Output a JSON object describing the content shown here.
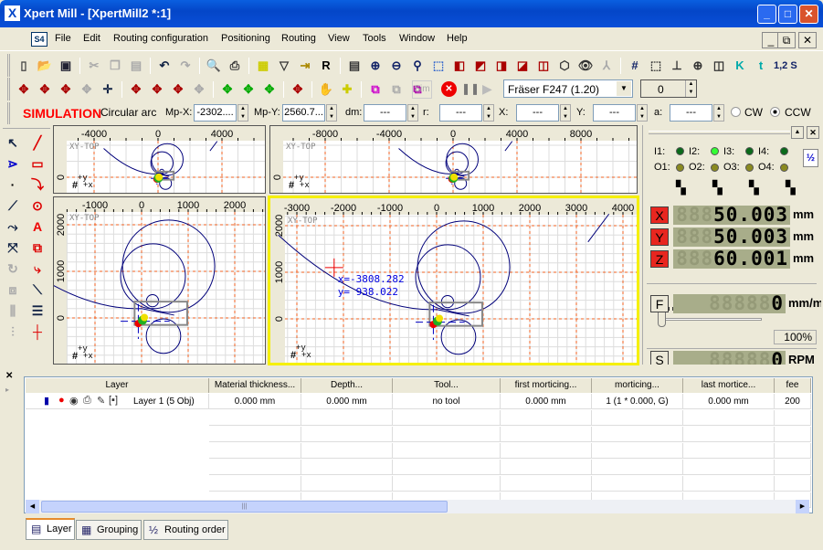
{
  "window": {
    "title": "Xpert Mill - [XpertMill2 *:1]",
    "app_icon": "X",
    "minimize": "_",
    "maximize": "□",
    "close": "✕"
  },
  "menu": {
    "logo": "S4",
    "items": [
      "File",
      "Edit",
      "Routing configuration",
      "Positioning",
      "Routing",
      "View",
      "Tools",
      "Window",
      "Help"
    ],
    "mdi": [
      "_",
      "⧉",
      "✕"
    ]
  },
  "toolbar1": [
    {
      "name": "new-icon",
      "g": "▯",
      "c": "#444"
    },
    {
      "name": "open-icon",
      "g": "📂",
      "c": "#c90"
    },
    {
      "name": "save-icon",
      "g": "▣",
      "c": "#223"
    },
    {
      "sep": true
    },
    {
      "name": "cut-icon",
      "g": "✂",
      "c": "#aaa"
    },
    {
      "name": "copy-icon",
      "g": "❐",
      "c": "#aaa"
    },
    {
      "name": "paste-icon",
      "g": "▤",
      "c": "#aaa"
    },
    {
      "sep": true
    },
    {
      "name": "undo-icon",
      "g": "↶",
      "c": "#124"
    },
    {
      "name": "redo-icon",
      "g": "↷",
      "c": "#aaa"
    },
    {
      "sep": true
    },
    {
      "name": "print-preview-icon",
      "g": "🔍",
      "c": "#333"
    },
    {
      "name": "print-icon",
      "g": "⎙",
      "c": "#333"
    },
    {
      "sep": true
    },
    {
      "name": "layer-icon",
      "g": "▦",
      "c": "#cc0"
    },
    {
      "name": "filter-icon",
      "g": "▽",
      "c": "#333"
    },
    {
      "name": "import-icon",
      "g": "⇥",
      "c": "#a80"
    },
    {
      "name": "r-icon",
      "g": "R",
      "c": "#000"
    },
    {
      "sep": true
    },
    {
      "name": "fit-view-icon",
      "g": "▤",
      "c": "#333"
    },
    {
      "name": "zoom-in-icon",
      "g": "⊕",
      "c": "#126"
    },
    {
      "name": "zoom-out-icon",
      "g": "⊖",
      "c": "#126"
    },
    {
      "name": "zoom-icon",
      "g": "⚲",
      "c": "#126"
    },
    {
      "name": "view-3d-icon",
      "g": "⬚",
      "c": "#36c"
    },
    {
      "name": "cube-front-icon",
      "g": "◧",
      "c": "#a00"
    },
    {
      "name": "cube-top-icon",
      "g": "◩",
      "c": "#a00"
    },
    {
      "name": "cube-side-icon",
      "g": "◨",
      "c": "#a00"
    },
    {
      "name": "cube-back-icon",
      "g": "◪",
      "c": "#a00"
    },
    {
      "name": "cube-iso-icon",
      "g": "◫",
      "c": "#a00"
    },
    {
      "name": "cube-wire-icon",
      "g": "⬡",
      "c": "#333"
    },
    {
      "name": "eye-icon",
      "g": "👁",
      "c": "#333"
    },
    {
      "name": "axes-icon",
      "g": "⅄",
      "c": "#aaa"
    },
    {
      "sep": true
    },
    {
      "name": "grid-icon",
      "g": "#",
      "c": "#126"
    },
    {
      "name": "selection-icon",
      "g": "⬚",
      "c": "#333"
    },
    {
      "name": "dimension-icon",
      "g": "⊥",
      "c": "#333"
    },
    {
      "name": "snap-icon",
      "g": "⊕",
      "c": "#333"
    },
    {
      "name": "panel-icon",
      "g": "◫",
      "c": "#333"
    },
    {
      "name": "k-icon",
      "g": "K",
      "c": "#0aa"
    },
    {
      "name": "t-icon",
      "g": "t",
      "c": "#0aa"
    },
    {
      "name": "numbering-icon",
      "g": "1,2 S",
      "c": "#126"
    }
  ],
  "toolbar2": [
    {
      "name": "move-r1-icon",
      "g": "✥",
      "c": "#a00"
    },
    {
      "name": "move-r2-icon",
      "g": "✥",
      "c": "#a00"
    },
    {
      "name": "move-r3-icon",
      "g": "✥",
      "c": "#a00"
    },
    {
      "name": "move-r4-icon",
      "g": "✥",
      "c": "#aaa"
    },
    {
      "name": "move-icon",
      "g": "✛",
      "c": "#124"
    },
    {
      "sep": true
    },
    {
      "name": "move-n1-icon",
      "g": "✥",
      "c": "#a00"
    },
    {
      "name": "move-n2-icon",
      "g": "✥",
      "c": "#a00"
    },
    {
      "name": "move-n3-icon",
      "g": "✥",
      "c": "#a00"
    },
    {
      "name": "move-n4-icon",
      "g": "✥",
      "c": "#aaa"
    },
    {
      "sep": true
    },
    {
      "name": "move-w1-icon",
      "g": "✥",
      "c": "#0a0"
    },
    {
      "name": "move-w2-icon",
      "g": "✥",
      "c": "#0a0"
    },
    {
      "name": "move-w3-icon",
      "g": "✥",
      "c": "#0a0"
    },
    {
      "sep": true
    },
    {
      "name": "move-z-icon",
      "g": "✥",
      "c": "#a00"
    },
    {
      "sep": true
    },
    {
      "name": "hand-icon",
      "g": "✋",
      "c": "#333"
    },
    {
      "name": "crosshair-icon",
      "g": "✚",
      "c": "#cc0"
    },
    {
      "sep": true
    },
    {
      "name": "machine-icon",
      "g": "⧉",
      "c": "#c0c"
    },
    {
      "name": "machine-disabled-icon",
      "g": "⧉",
      "c": "#aaa"
    },
    {
      "name": "machine-stop-icon",
      "g": "⧉",
      "c": "#a0a"
    }
  ],
  "toolbar2_extra": {
    "sim": "Sim",
    "stop_icon": "✕",
    "pause_icon": "❚❚",
    "play_icon": "▶",
    "tool_select": "Fräser F247 (1.20)",
    "counter": "0"
  },
  "simbar": {
    "mode": "SIMULATION",
    "type": "Circular arc",
    "mpx_label": "Mp-X:",
    "mpx": "-2302....",
    "mpy_label": "Mp-Y:",
    "mpy": "2560.7...",
    "dm_label": "dm:",
    "dm": "---",
    "r_label": "r:",
    "r": "---",
    "x_label": "X:",
    "x": "---",
    "y_label": "Y:",
    "y": "---",
    "a_label": "a:",
    "a": "---",
    "cw": "CW",
    "ccw": "CCW",
    "selected_direction": "CCW",
    "mode_color": "#ff0000"
  },
  "views": [
    {
      "label": "XY-TOP",
      "xticks": [
        "-4000",
        "0",
        "4000"
      ],
      "yticks": [
        "0"
      ]
    },
    {
      "label": "XY-TOP",
      "xticks": [
        "-8000",
        "-4000",
        "0",
        "4000",
        "8000"
      ],
      "yticks": [
        "0"
      ]
    },
    {
      "label": "XY-TOP",
      "xticks": [
        "-1000",
        "0",
        "1000",
        "2000"
      ],
      "yticks": [
        "2000",
        "1000",
        "0"
      ]
    },
    {
      "label": "XY-TOP",
      "xticks": [
        "-3000",
        "-2000",
        "-1000",
        "0",
        "1000",
        "2000",
        "3000",
        "4000"
      ],
      "yticks": [
        "2000",
        "1000",
        "0"
      ],
      "cursor": {
        "x": "x=-3808.282",
        "y": "y=  938.022"
      },
      "active": true
    }
  ],
  "axis_markers": {
    "y": "+y",
    "x": "+x"
  },
  "io": {
    "inputs": [
      {
        "label": "I1:",
        "on": false
      },
      {
        "label": "I2:",
        "on": true
      },
      {
        "label": "I3:",
        "on": false
      },
      {
        "label": "I4:",
        "on": false
      }
    ],
    "outputs": [
      {
        "label": "O1:"
      },
      {
        "label": "O2:"
      },
      {
        "label": "O3:"
      },
      {
        "label": "O4:"
      }
    ],
    "half_button": "½",
    "switch_icons": [
      "switch-icon",
      "switch-icon",
      "switch-icon",
      "switch-icon"
    ]
  },
  "dro": {
    "x": {
      "axis": "X",
      "value": "50.003",
      "unit": "mm"
    },
    "y": {
      "axis": "Y",
      "value": "50.003",
      "unit": "mm"
    },
    "z": {
      "axis": "Z",
      "value": "60.001",
      "unit": "mm"
    },
    "f": {
      "axis": "F",
      "value": "0",
      "unit": "mm/min"
    },
    "feed_override": "100%",
    "feed_override_value": 100,
    "s": {
      "axis": "S",
      "value": "0",
      "unit": "RPM"
    }
  },
  "table": {
    "columns": [
      "Layer",
      "Material thickness...",
      "Depth...",
      "Tool...",
      "first morticing...",
      "morticing...",
      "last mortice...",
      "fee"
    ],
    "rows": [
      [
        "Layer 1 (5 Obj)",
        "0.000 mm",
        "0.000 mm",
        "no tool",
        "0.000 mm",
        "1 (1 * 0.000, G)",
        "0.000 mm",
        "200"
      ]
    ]
  },
  "tabs": [
    {
      "label": "Layer",
      "active": true
    },
    {
      "label": "Grouping"
    },
    {
      "label": "Routing order"
    }
  ]
}
